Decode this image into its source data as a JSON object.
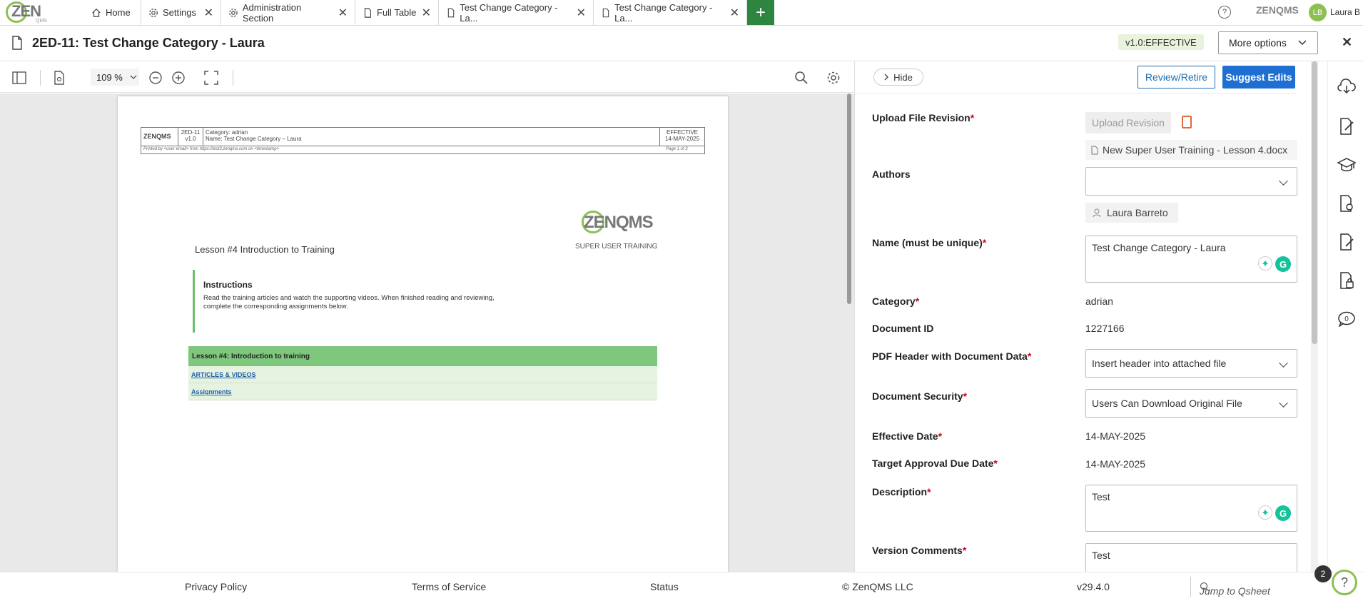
{
  "app": {
    "logo_text": "ZEN",
    "logo_sub": "QMS",
    "brand_mini": "ZENQMS",
    "user_initials": "LB",
    "user_name": "Laura B"
  },
  "tabs": [
    {
      "label": "Home",
      "icon": "home-icon",
      "closable": false
    },
    {
      "label": "Settings",
      "icon": "gear-icon",
      "closable": true
    },
    {
      "label": "Administration Section",
      "icon": "gear-icon",
      "closable": true
    },
    {
      "label": "Full Table",
      "icon": "document-icon",
      "closable": true
    },
    {
      "label": "Test Change Category - La...",
      "icon": "document-icon",
      "closable": true
    },
    {
      "label": "Test Change Category - La...",
      "icon": "document-icon",
      "closable": true,
      "active": true
    }
  ],
  "header": {
    "title": "2ED-11: Test Change Category - Laura",
    "status": "v1.0:EFFECTIVE",
    "more_options": "More options"
  },
  "viewer": {
    "zoom": "109 %"
  },
  "pdf": {
    "header": {
      "logo": "ZENQMS",
      "doc_id": "2ED-11",
      "version": "v1.0",
      "category_line": "Category: adrian",
      "name_line": "Name: Test Change Category – Laura",
      "status": "EFFECTIVE",
      "date": "14-MAY-2025",
      "printed_by": "Printed by <user email> from https://test3.zenqms.com on <timestamp>",
      "page": "Page 1 of 2"
    },
    "brand": "ZENQMS",
    "brand_sub": "SUPER USER TRAINING",
    "lesson_heading": "Lesson #4 Introduction to Training",
    "instructions_title": "Instructions",
    "instructions_text": "Read the training articles and watch the supporting videos. When finished reading and reviewing, complete the corresponding assignments below.",
    "table_head": "Lesson #4: Introduction to training",
    "table_rows": [
      "ARTICLES & VIDEOS",
      "Assignments"
    ]
  },
  "panel": {
    "hide": "Hide",
    "review_retire": "Review/Retire",
    "suggest_edits": "Suggest Edits",
    "fields": {
      "upload_label": "Upload File Revision",
      "upload_button": "Upload Revision",
      "file_name": "New Super User Training - Lesson 4.docx",
      "authors_label": "Authors",
      "authors_select": "",
      "author_chip": "Laura Barreto",
      "name_label": "Name (must be unique)",
      "name_value": "Test Change Category - Laura",
      "category_label": "Category",
      "category_value": "adrian",
      "docid_label": "Document ID",
      "docid_value": "1227166",
      "pdfheader_label": "PDF Header with Document Data",
      "pdfheader_value": "Insert header into attached file",
      "security_label": "Document Security",
      "security_value": "Users Can Download Original File",
      "effective_label": "Effective Date",
      "effective_value": "14-MAY-2025",
      "target_label": "Target Approval Due Date",
      "target_value": "14-MAY-2025",
      "description_label": "Description",
      "description_value": "Test",
      "version_label": "Version Comments",
      "version_value": "Test"
    }
  },
  "rail": [
    "cloud-download-icon",
    "document-edit-icon",
    "graduation-cap-icon",
    "document-link-icon",
    "document-sign-icon",
    "document-lock-icon",
    "comment-icon"
  ],
  "rail_comment_count": "0",
  "footer": {
    "privacy": "Privacy Policy",
    "terms": "Terms of Service",
    "status": "Status",
    "copyright": "© ZenQMS LLC",
    "version": "v29.4.0",
    "jump_placeholder": "Jump to Qsheet",
    "notif_count": "2"
  },
  "colors": {
    "accent_green": "#8cc152",
    "primary_blue": "#1f6fd2",
    "required_red": "#d0021b"
  }
}
